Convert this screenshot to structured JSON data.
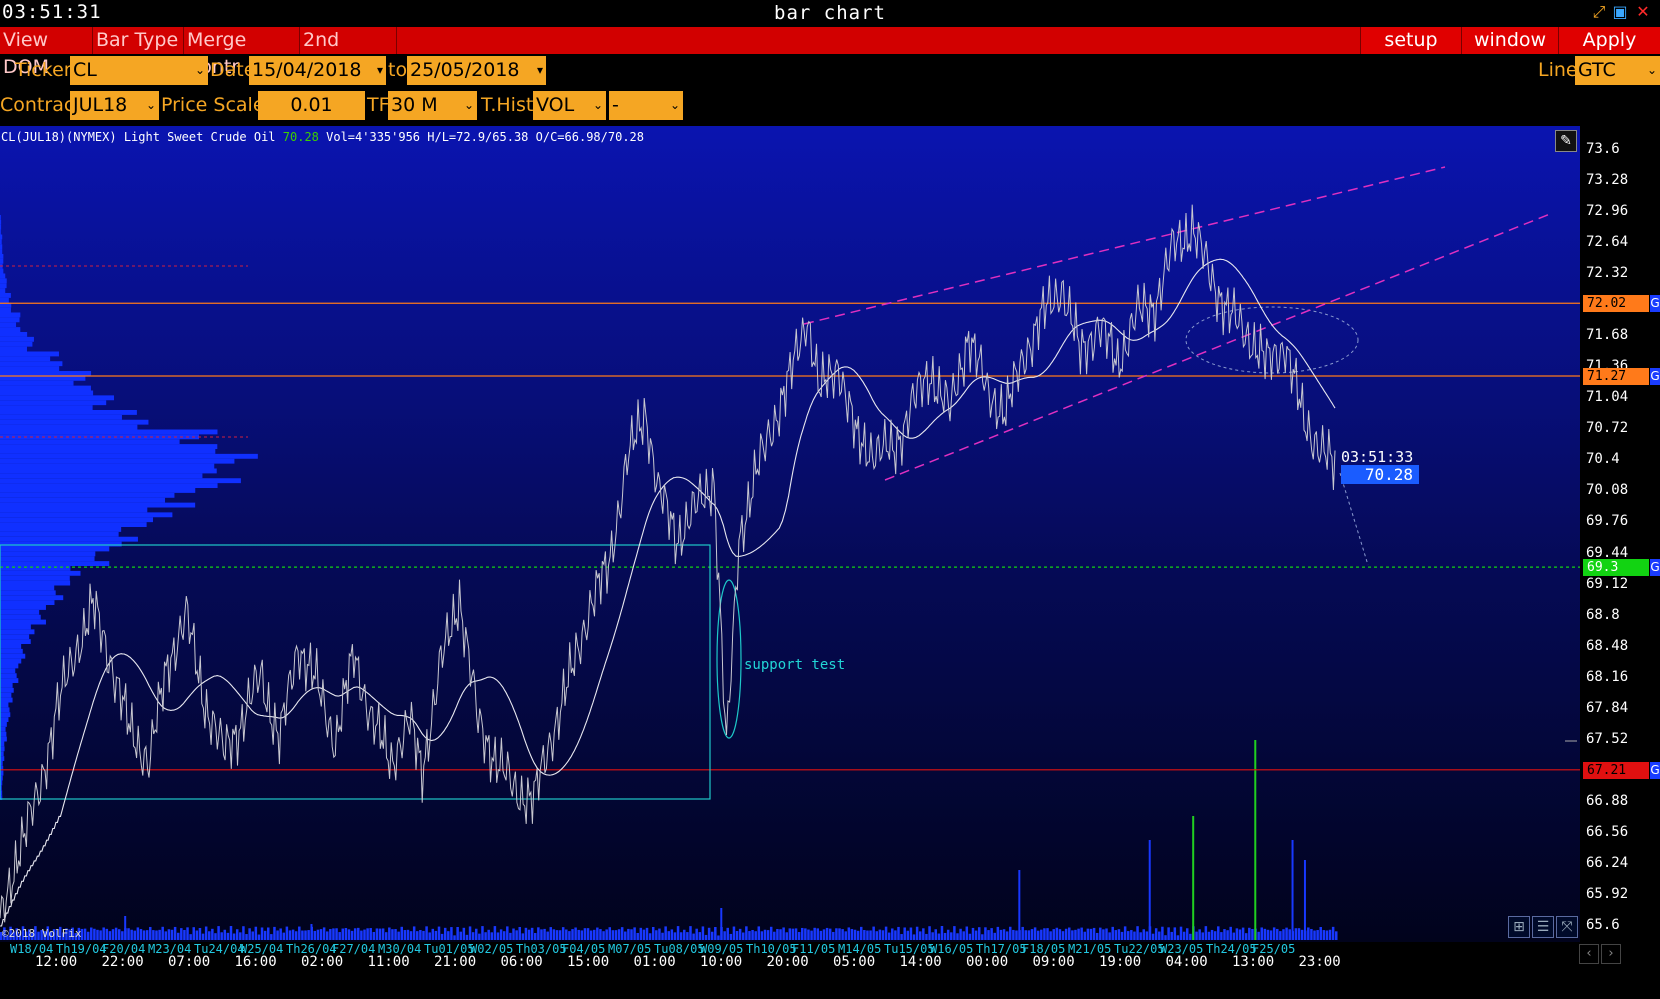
{
  "titlebar": {
    "clock": "03:51:31",
    "title": "bar chart"
  },
  "menu": {
    "left": [
      "View DOM",
      "Bar Type",
      "Merge Contr",
      "2nd Chart"
    ],
    "right": [
      "setup",
      "window",
      "Apply"
    ]
  },
  "controls": {
    "ticker_label": "Ticker",
    "ticker": "CL",
    "date_label": "Date",
    "date_from": "15/04/2018",
    "to_label": "to",
    "date_to": "25/05/2018",
    "line_label": "Line",
    "line": "GTC",
    "contract_label": "Contract",
    "contract": "JUL18",
    "price_scale_label": "Price Scale",
    "price_scale": "0.01",
    "tf_label": "TF",
    "tf": "30 M",
    "thist_label": "T.Hist",
    "thist": "VOL",
    "extra": "-"
  },
  "info": {
    "prefix": "CL(JUL18)(NYMEX) Light Sweet Crude Oil ",
    "last": "70.28",
    "rest": " Vol=4'335'956 H/L=72.9/65.38 O/C=66.98/70.28"
  },
  "annotation": "support test",
  "copyright": "©2018 VolFix",
  "last_time": "03:51:33",
  "last_price": "70.28",
  "levels": [
    {
      "label": "72.02",
      "value": 72.02,
      "color": "#ff7a1a"
    },
    {
      "label": "71.27",
      "value": 71.27,
      "color": "#ff7a1a"
    },
    {
      "label": "69.3",
      "value": 69.3,
      "color": "#12d312"
    },
    {
      "label": "67.21",
      "value": 67.21,
      "color": "#e01010"
    }
  ],
  "level_tag": "G",
  "chart_data": {
    "type": "line",
    "y_ticks": [
      "73.6",
      "73.28",
      "72.96",
      "72.64",
      "72.32",
      "72.0",
      "71.68",
      "71.36",
      "71.04",
      "70.72",
      "70.4",
      "70.08",
      "69.76",
      "69.44",
      "69.12",
      "68.8",
      "68.48",
      "68.16",
      "67.84",
      "67.52",
      "67.2",
      "66.88",
      "66.56",
      "66.24",
      "65.92",
      "65.6"
    ],
    "ylim": [
      65.5,
      73.75
    ],
    "x_dates": [
      "18/04",
      "19/04",
      "20/04",
      "23/04",
      "24/04",
      "25/04",
      "26/04",
      "27/04",
      "30/04",
      "01/05",
      "02/05",
      "03/05",
      "04/05",
      "07/05",
      "08/05",
      "09/05",
      "10/05",
      "11/05",
      "14/05",
      "15/05",
      "16/05",
      "17/05",
      "18/05",
      "21/05",
      "22/05",
      "23/05",
      "24/05",
      "25/05"
    ],
    "x_weekdays": [
      "W",
      "Th",
      "F",
      "M",
      "Tu",
      "W",
      "Th",
      "F",
      "M",
      "Tu",
      "W",
      "Th",
      "F",
      "M",
      "Tu",
      "W",
      "Th",
      "F",
      "M",
      "Tu",
      "W",
      "Th",
      "F",
      "M",
      "Tu",
      "W",
      "Th",
      "F"
    ],
    "x_times": [
      "12:00",
      "22:00",
      "07:00",
      "16:00",
      "02:00",
      "11:00",
      "21:00",
      "06:00",
      "15:00",
      "01:00",
      "10:00",
      "20:00",
      "05:00",
      "14:00",
      "00:00",
      "09:00",
      "19:00",
      "04:00",
      "13:00",
      "23:00"
    ],
    "price_waypoints": [
      [
        0,
        65.6
      ],
      [
        3,
        66.4
      ],
      [
        6,
        66.9
      ],
      [
        9,
        67.8
      ],
      [
        12,
        68.4
      ],
      [
        15,
        68.9
      ],
      [
        18,
        68.3
      ],
      [
        21,
        67.6
      ],
      [
        24,
        67.3
      ],
      [
        27,
        68.3
      ],
      [
        30,
        68.8
      ],
      [
        33,
        67.9
      ],
      [
        36,
        67.4
      ],
      [
        39,
        67.7
      ],
      [
        42,
        68.2
      ],
      [
        45,
        67.5
      ],
      [
        48,
        68.5
      ],
      [
        51,
        68.1
      ],
      [
        54,
        67.5
      ],
      [
        57,
        68.4
      ],
      [
        60,
        67.7
      ],
      [
        63,
        67.3
      ],
      [
        66,
        67.7
      ],
      [
        68,
        67.2
      ],
      [
        71,
        68.3
      ],
      [
        74,
        69.0
      ],
      [
        77,
        67.7
      ],
      [
        80,
        67.3
      ],
      [
        83,
        67.0
      ],
      [
        86,
        66.9
      ],
      [
        89,
        67.6
      ],
      [
        92,
        68.2
      ],
      [
        95,
        68.9
      ],
      [
        98,
        69.3
      ],
      [
        101,
        70.4
      ],
      [
        104,
        70.9
      ],
      [
        106,
        70.1
      ],
      [
        109,
        69.6
      ],
      [
        112,
        69.9
      ],
      [
        115,
        70.2
      ],
      [
        117,
        67.4
      ],
      [
        119,
        69.6
      ],
      [
        122,
        70.3
      ],
      [
        124,
        70.7
      ],
      [
        127,
        71.2
      ],
      [
        130,
        71.9
      ],
      [
        132,
        71.1
      ],
      [
        135,
        71.4
      ],
      [
        138,
        70.6
      ],
      [
        141,
        70.5
      ],
      [
        144,
        70.5
      ],
      [
        147,
        71.0
      ],
      [
        150,
        71.3
      ],
      [
        153,
        70.9
      ],
      [
        156,
        71.7
      ],
      [
        159,
        71.1
      ],
      [
        162,
        70.9
      ],
      [
        165,
        71.5
      ],
      [
        168,
        71.9
      ],
      [
        171,
        72.2
      ],
      [
        174,
        71.5
      ],
      [
        177,
        71.8
      ],
      [
        180,
        71.4
      ],
      [
        183,
        71.9
      ],
      [
        186,
        72.0
      ],
      [
        189,
        72.6
      ],
      [
        192,
        72.8
      ],
      [
        195,
        72.3
      ],
      [
        198,
        71.9
      ],
      [
        201,
        71.7
      ],
      [
        204,
        71.4
      ],
      [
        207,
        71.6
      ],
      [
        210,
        70.8
      ],
      [
        213,
        70.5
      ],
      [
        215,
        70.3
      ]
    ],
    "volume_profile": [
      1,
      2,
      3,
      6,
      10,
      18,
      30,
      55,
      80,
      100,
      130,
      190,
      225,
      210,
      170,
      150,
      120,
      95,
      70,
      55,
      40,
      30,
      22,
      16,
      12,
      9,
      6,
      4,
      3,
      2
    ],
    "volume_spikes": [
      [
        20,
        0.12
      ],
      [
        50,
        0.08
      ],
      [
        116,
        0.16
      ],
      [
        164,
        0.35
      ],
      [
        185,
        0.5
      ],
      [
        192,
        0.62
      ],
      [
        202,
        1.0
      ],
      [
        208,
        0.5
      ],
      [
        210,
        0.4
      ]
    ]
  }
}
